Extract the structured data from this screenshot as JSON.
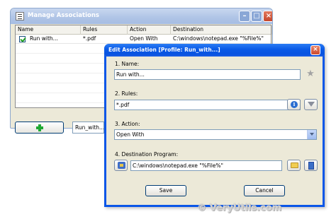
{
  "manage_window": {
    "title": "Manage Associations",
    "columns": [
      "Name",
      "Rules",
      "Action",
      "Destination"
    ],
    "rows": [
      {
        "checked": true,
        "name": "Run with...",
        "rules": "*.pdf",
        "action": "Open With",
        "destination": "C:\\windows\\notepad.exe \"%File%\""
      }
    ],
    "add_button_icon": "plus-icon",
    "profile_combo_value": "Run_with..."
  },
  "edit_dialog": {
    "title": "Edit Association [Profile: Run_with...]",
    "close_label": "×",
    "name_label": "1. Name:",
    "name_value": "Run with...",
    "rules_label": "2. Rules:",
    "rules_value": "*.pdf",
    "action_label": "3. Action:",
    "action_value": "Open With",
    "destination_label": "4. Destination Program:",
    "destination_value": "C:\\windows\\notepad.exe \"%File%\"",
    "save_label": "Save",
    "cancel_label": "Cancel"
  },
  "watermark": "© VeryUtils.com",
  "colors": {
    "dialog_titlebar": "#0a5ae6",
    "back_titlebar": "#afc4e6",
    "window_face": "#ece9d8"
  }
}
